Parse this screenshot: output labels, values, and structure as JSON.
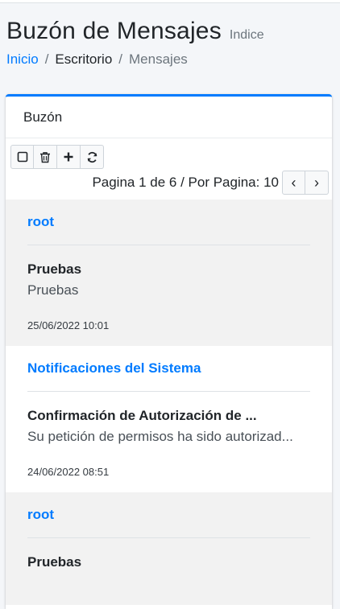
{
  "header": {
    "title": "Buzón de Mensajes",
    "subtitle": "Indice"
  },
  "breadcrumb": {
    "items": [
      "Inicio",
      "Escritorio",
      "Mensajes"
    ],
    "separator": "/"
  },
  "card": {
    "title": "Buzón"
  },
  "toolbar": {
    "icons": [
      "checkbox-icon",
      "trash-icon",
      "plus-icon",
      "refresh-icon"
    ],
    "pager_text": "Pagina 1 de 6 / Por Pagina: 10",
    "prev_symbol": "‹",
    "next_symbol": "›"
  },
  "messages": [
    {
      "from": "root",
      "subject": "Pruebas",
      "preview": "Pruebas",
      "date": "25/06/2022 10:01"
    },
    {
      "from": "Notificaciones del Sistema",
      "subject": "Confirmación de Autorización de ...",
      "preview": "Su petición de permisos ha sido autorizad...",
      "date": "24/06/2022 08:51"
    },
    {
      "from": "root",
      "subject": "Pruebas",
      "preview": "",
      "date": ""
    }
  ],
  "colors": {
    "accent": "#007bff",
    "row_alt": "#f2f2f2",
    "background": "#f4f6f9"
  }
}
